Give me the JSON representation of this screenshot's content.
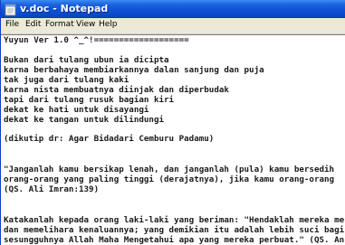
{
  "window": {
    "title": "v.doc - Notepad"
  },
  "menu": {
    "items": [
      "File",
      "Edit",
      "Format",
      "View",
      "Help"
    ]
  },
  "document": {
    "lines": [
      "Yuyun Ver 1.0 ^_^!===================",
      "",
      "Bukan dari tulang ubun ia dicipta",
      "karna berbahaya membiarkannya dalan sanjung dan puja",
      "tak juga dari tulang kaki",
      "karna nista membuatnya diinjak dan diperbudak",
      "tapi dari tulang rusuk bagian kiri",
      "dekat ke hati untuk disayangi",
      "dekat ke tangan untuk dilindungi",
      "",
      "(dikutip dr: Agar Bidadari Cemburu Padamu)",
      "",
      "",
      "\"Janganlah kamu bersikap lenah, dan janganlah (pula) kamu bersedih",
      "orang-orang yang paling tinggi (derajatnya), jika kamu orang-orang",
      "(QS. Ali Imran:139)",
      "",
      "",
      "Katakanlah kepada orang laki-laki yang beriman: \"Hendaklah mereka me",
      "dan memelihara kenaluannya; yang demikian itu adalah lebih suci bagi",
      "sesungguhnya Allah Maha Mengetahui apa yang mereka perbuat.\" (QS. An"
    ]
  },
  "colors": {
    "titlebar": "#0c52d8",
    "menubar": "#ece9d8",
    "editor_bg": "#ffffff",
    "text": "#1a1a1a"
  }
}
